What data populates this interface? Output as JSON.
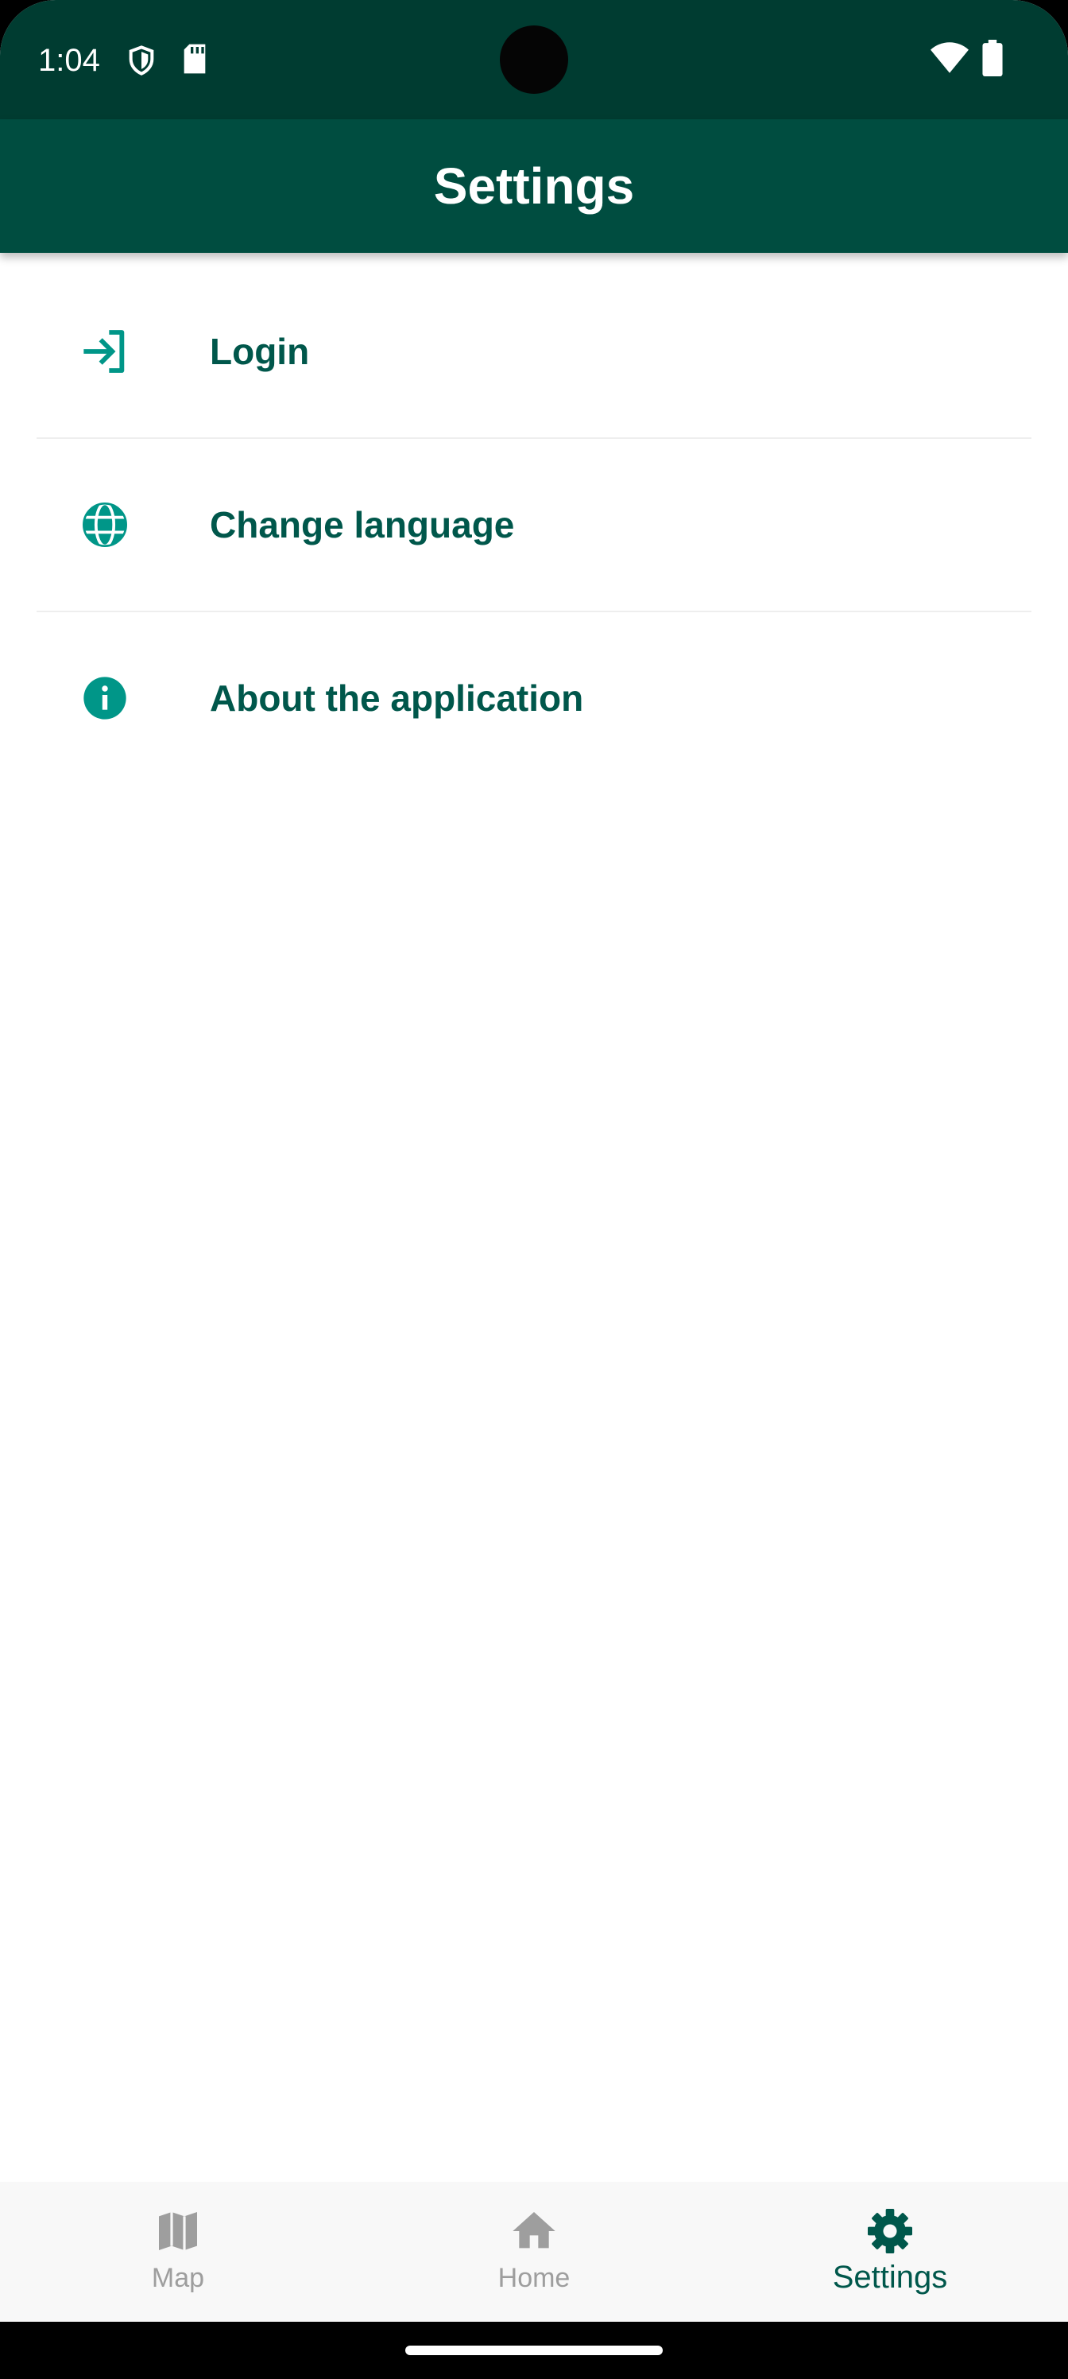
{
  "status_bar": {
    "time": "1:04",
    "icons": [
      "shield-icon",
      "sd-card-icon",
      "wifi-icon",
      "battery-icon"
    ]
  },
  "app_bar": {
    "title": "Settings"
  },
  "settings": {
    "items": [
      {
        "label": "Login",
        "icon": "login-icon"
      },
      {
        "label": "Change language",
        "icon": "globe-icon"
      },
      {
        "label": "About the application",
        "icon": "info-icon"
      }
    ]
  },
  "bottom_nav": {
    "items": [
      {
        "label": "Map",
        "icon": "map-icon",
        "active": false
      },
      {
        "label": "Home",
        "icon": "home-icon",
        "active": false
      },
      {
        "label": "Settings",
        "icon": "gear-icon",
        "active": true
      }
    ]
  },
  "colors": {
    "status_bar": "#003c31",
    "app_bar": "#004d40",
    "accent_icon": "#009688",
    "label_text": "#00574b",
    "inactive_nav": "#9e9e9e"
  }
}
